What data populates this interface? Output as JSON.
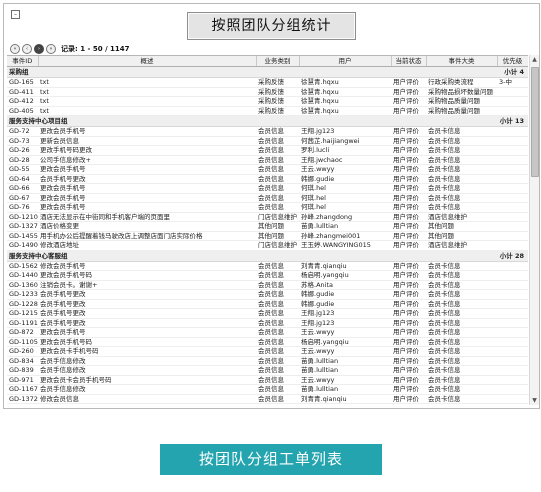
{
  "window": {
    "corner_icon": "minimize-icon"
  },
  "header": {
    "title": "按照团队分组统计"
  },
  "pager": {
    "buttons": [
      "«",
      "‹",
      "›",
      "»"
    ],
    "record_label": "记录: 1 - 50 / 1147"
  },
  "table": {
    "columns": [
      "事件ID",
      "概述",
      "业务类别",
      "用户",
      "当前状态",
      "事件大类",
      "优先级"
    ],
    "rows": [
      {
        "kind": "group",
        "name": "采购组",
        "summary": "小计 4"
      },
      {
        "kind": "row",
        "cells": [
          "GD-165",
          "txt",
          "采购反馈",
          "徐慧青.hqxu",
          "用户评价",
          "行政采购类流程",
          "3-中"
        ]
      },
      {
        "kind": "row",
        "cells": [
          "GD-411",
          "txt",
          "采购反馈",
          "徐慧青.hqxu",
          "用户评价",
          "采购物品损坏数量问题",
          ""
        ]
      },
      {
        "kind": "row",
        "cells": [
          "GD-412",
          "txt",
          "采购反馈",
          "徐慧青.hqxu",
          "用户评价",
          "采购物品质量问题",
          ""
        ]
      },
      {
        "kind": "row",
        "cells": [
          "GD-405",
          "txt",
          "采购反馈",
          "徐慧青.hqxu",
          "用户评价",
          "采购物品质量问题",
          ""
        ]
      },
      {
        "kind": "group",
        "name": "服务支持中心项目组",
        "summary": "小计 13"
      },
      {
        "kind": "row",
        "cells": [
          "GD-72",
          "更改会员手机号",
          "会员信息",
          "王翔.jg123",
          "用户评价",
          "会员卡信息",
          ""
        ]
      },
      {
        "kind": "row",
        "cells": [
          "GD-73",
          "更新会员信息",
          "会员信息",
          "何茜芷.haijiangwei",
          "用户评价",
          "会员卡信息",
          ""
        ]
      },
      {
        "kind": "row",
        "cells": [
          "GD-26",
          "更改手机号码更改",
          "会员信息",
          "罗利.lucli",
          "用户评价",
          "会员卡信息",
          ""
        ]
      },
      {
        "kind": "row",
        "cells": [
          "GD-28",
          "公司手信息修改+",
          "会员信息",
          "王翔.jwchaoc",
          "用户评价",
          "会员卡信息",
          ""
        ]
      },
      {
        "kind": "row",
        "cells": [
          "GD-55",
          "更改会员手机号",
          "会员信息",
          "王云.wwyy",
          "用户评价",
          "会员卡信息",
          ""
        ]
      },
      {
        "kind": "row",
        "cells": [
          "GD-64",
          "会员手机号更改",
          "会员信息",
          "韩娜.gudie",
          "用户评价",
          "会员卡信息",
          ""
        ]
      },
      {
        "kind": "row",
        "cells": [
          "GD-66",
          "更改会员手机号",
          "会员信息",
          "何琪.hel",
          "用户评价",
          "会员卡信息",
          ""
        ]
      },
      {
        "kind": "row",
        "cells": [
          "GD-67",
          "更改会员手机号",
          "会员信息",
          "何琪.hel",
          "用户评价",
          "会员卡信息",
          ""
        ]
      },
      {
        "kind": "row",
        "cells": [
          "GD-76",
          "更改会员手机号",
          "会员信息",
          "何琪.hel",
          "用户评价",
          "会员卡信息",
          ""
        ]
      },
      {
        "kind": "row",
        "cells": [
          "GD-1210",
          "酒店无法显示在中街同和手机客户端的页面里",
          "门店信息维护",
          "孙峰.zhangdong",
          "用户评价",
          "酒店信息维护",
          ""
        ]
      },
      {
        "kind": "row",
        "cells": [
          "GD-1327",
          "酒店价格变更",
          "其他问题",
          "苗勇.lulltian",
          "用户评价",
          "其他问题",
          ""
        ]
      },
      {
        "kind": "row",
        "cells": [
          "GD-1455",
          "用手机办公后提醒着钱马驶改店上调整店面门店实际价格",
          "其他问题",
          "孙峰.zhangmei001",
          "用户评价",
          "其他问题",
          ""
        ]
      },
      {
        "kind": "row",
        "cells": [
          "GD-1490",
          "修改酒店地址",
          "门店信息维护",
          "王玉婷.WANGYING015",
          "用户评价",
          "酒店信息维护",
          ""
        ]
      },
      {
        "kind": "group",
        "name": "服务支持中心客服组",
        "summary": "小计 28"
      },
      {
        "kind": "row",
        "cells": [
          "GD-1562",
          "修改会员手机号",
          "会员信息",
          "刘青青.qianqiu",
          "用户评价",
          "会员卡信息",
          ""
        ]
      },
      {
        "kind": "row",
        "cells": [
          "GD-1440",
          "更改会员手机号码",
          "会员信息",
          "杨启明.yangqiu",
          "用户评价",
          "会员卡信息",
          ""
        ]
      },
      {
        "kind": "row",
        "cells": [
          "GD-1360",
          "注销会员卡。谢谢+",
          "会员信息",
          "苏格.Anita",
          "用户评价",
          "会员卡信息",
          ""
        ]
      },
      {
        "kind": "row",
        "cells": [
          "GD-1233",
          "会员手机号更改",
          "会员信息",
          "韩娜.gudie",
          "用户评价",
          "会员卡信息",
          ""
        ]
      },
      {
        "kind": "row",
        "cells": [
          "GD-1228",
          "会员手机号更改",
          "会员信息",
          "韩娜.gudie",
          "用户评价",
          "会员卡信息",
          ""
        ]
      },
      {
        "kind": "row",
        "cells": [
          "GD-1215",
          "会员手机号更改",
          "会员信息",
          "王翔.jg123",
          "用户评价",
          "会员卡信息",
          ""
        ]
      },
      {
        "kind": "row",
        "cells": [
          "GD-1191",
          "会员手机号更改",
          "会员信息",
          "王翔.jg123",
          "用户评价",
          "会员卡信息",
          ""
        ]
      },
      {
        "kind": "row",
        "cells": [
          "GD-872",
          "更改会员手机号",
          "会员信息",
          "王云.wwyy",
          "用户评价",
          "会员卡信息",
          ""
        ]
      },
      {
        "kind": "row",
        "cells": [
          "GD-1105",
          "更改会员手机号码",
          "会员信息",
          "杨启明.yangqiu",
          "用户评价",
          "会员卡信息",
          ""
        ]
      },
      {
        "kind": "row",
        "cells": [
          "GD-260",
          "更改会员卡手机号码",
          "会员信息",
          "王云.wwyy",
          "用户评价",
          "会员卡信息",
          ""
        ]
      },
      {
        "kind": "row",
        "cells": [
          "GD-834",
          "会员手信息修改",
          "会员信息",
          "苗勇.lulltian",
          "用户评价",
          "会员卡信息",
          ""
        ]
      },
      {
        "kind": "row",
        "cells": [
          "GD-839",
          "会员手信息修改",
          "会员信息",
          "苗勇.lulltian",
          "用户评价",
          "会员卡信息",
          ""
        ]
      },
      {
        "kind": "row",
        "cells": [
          "GD-971",
          "更改会员卡会员手机号码",
          "会员信息",
          "王云.wwyy",
          "用户评价",
          "会员卡信息",
          ""
        ]
      },
      {
        "kind": "row",
        "cells": [
          "GD-1167",
          "会员手信息修改",
          "会员信息",
          "苗勇.lulltian",
          "用户评价",
          "会员卡信息",
          ""
        ]
      },
      {
        "kind": "row",
        "cells": [
          "GD-1372",
          "修改会员信息",
          "会员信息",
          "刘青青.qianqiu",
          "用户评价",
          "会员卡信息",
          ""
        ]
      }
    ]
  },
  "scrollbar": {
    "up_icon": "scroll-up-icon",
    "down_icon": "scroll-down-icon"
  },
  "caption": {
    "text": "按团队分组工单列表"
  },
  "colors": {
    "caption_bg": "#23a4ae",
    "header_bg": "#f0f0f0",
    "group_bg": "#efefef"
  }
}
